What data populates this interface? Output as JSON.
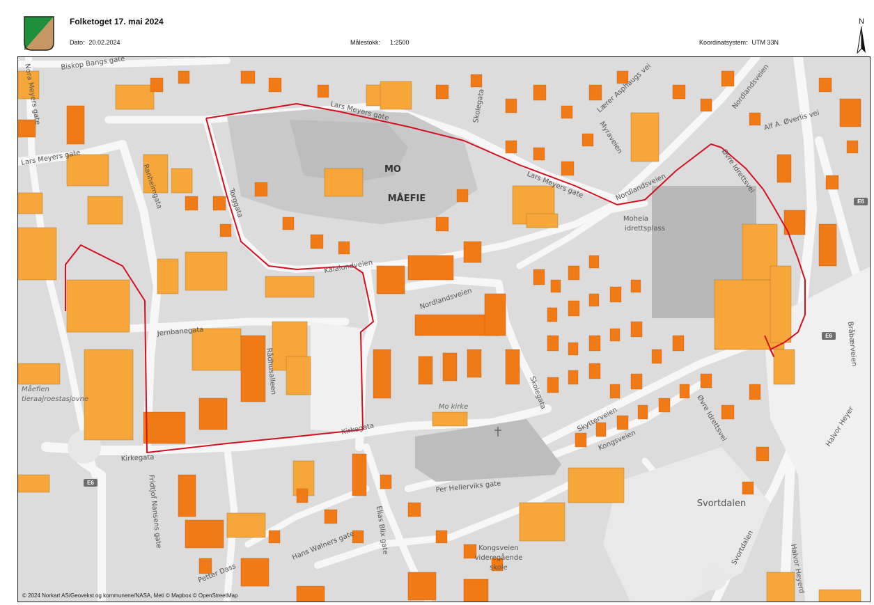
{
  "header": {
    "title": "Folketoget 17. mai 2024",
    "date_label": "Dato:",
    "date_value": "20.02.2024",
    "scale_label": "Målestokk:",
    "scale_value": "1:2500",
    "crs_label": "Koordinatsystem:",
    "crs_value": "UTM 33N",
    "north_label": "N"
  },
  "colors": {
    "route": "#d40f1f",
    "building": "#f7a63a",
    "building_dark": "#f07b16",
    "road": "#f7f7f7",
    "block": "#e3e3e3",
    "logo_green": "#1e8f3a",
    "logo_tan": "#c69663"
  },
  "map": {
    "places": {
      "city": "MO",
      "district": "MÅEFIE",
      "valley": "Svortdalen",
      "area_west_1": "Måefien",
      "area_west_2": "tieraajroestasjovne"
    },
    "poi": {
      "church": "Mo kirke",
      "sports_1": "Moheia",
      "sports_2": "idrettsplass",
      "school_1": "Kongsveien",
      "school_2": "videregående",
      "school_3": "skole"
    },
    "streets": {
      "biskop": "Biskop Bangs gate",
      "nora": "Nora Meyers gate",
      "lars_w": "Lars Meyers gate",
      "lars_n": "Lars Meyers gate",
      "lars_e": "Lars Meyers gate",
      "ranheim": "Ranheimgata",
      "torg": "Torggata",
      "skole_n": "Skolegata",
      "skole_s": "Skolegata",
      "laerer": "Lærer Asphaugs vei",
      "myra": "Myraveien",
      "nordlands_e": "Nordlandsveien",
      "nordlands_ne": "Nordlandsveien",
      "nordlands_c": "Nordlandsveien",
      "alf": "Alf A. Øverlis vei",
      "ovre_idretts_n": "Øvre Idrettsvei",
      "ovre_idretts_s": "Øvre Idrettsvei",
      "kaialund": "Kaialundveien",
      "jernbane": "Jernbanegata",
      "radhus": "Rådhusalleen",
      "kirke_w": "Kirkegata",
      "kirke_c": "Kirkegata",
      "skytter": "Skytterveien",
      "kongs": "Kongsveien",
      "per": "Per Hellerviks gate",
      "fridtjof": "Fridtjof Nansens gate",
      "elias": "Elias Blix gate",
      "hans": "Hans Wølners gate",
      "petter": "Petter Dass",
      "halvor_1": "Halvor Heyer",
      "halvor_2": "Halvor Heyerd",
      "braa": "Bråbærveien",
      "svort_road": "Svortdalen"
    },
    "road_shields": {
      "e6_a": "E6",
      "e6_b": "E6",
      "e6_c": "E6"
    },
    "attribution": "© 2024 Norkart AS/Geovekst og kommunene/NASA, Meti © Mapbox © OpenStreetMap"
  }
}
